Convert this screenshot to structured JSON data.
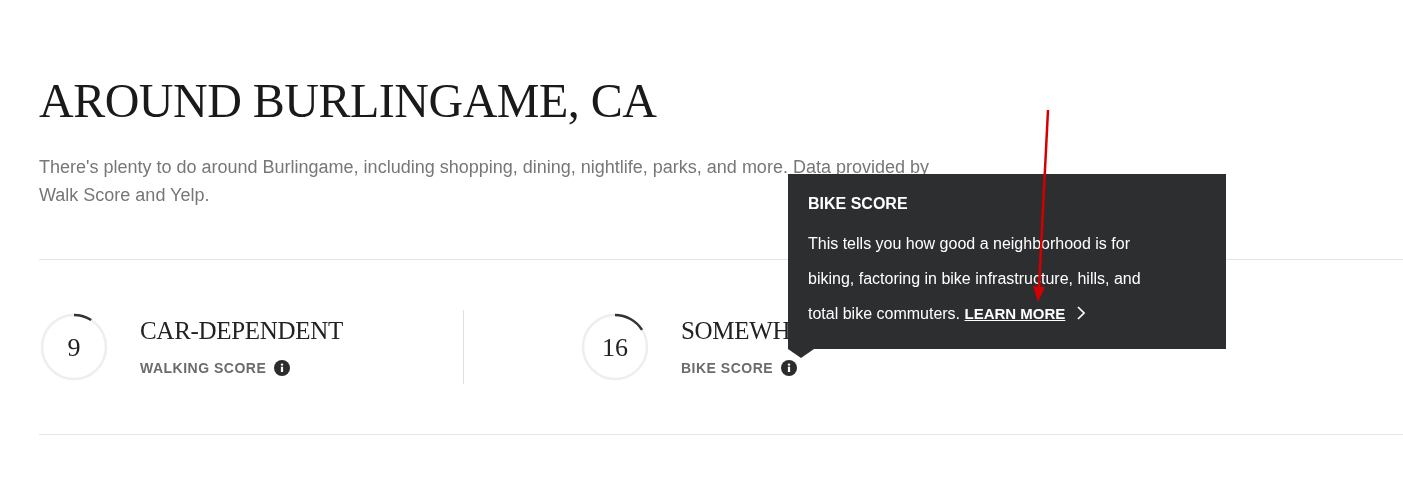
{
  "title": "AROUND BURLINGAME, CA",
  "intro_lines": [
    "There's plenty to do around Burlingame, including shopping, dining, nightlife, parks, and more. Data provided by",
    "Walk Score and Yelp."
  ],
  "scores": [
    {
      "value": "9",
      "level": 0.09,
      "heading": "CAR-DEPENDENT",
      "label": "WALKING SCORE"
    },
    {
      "value": "16",
      "level": 0.16,
      "heading": "SOMEWH",
      "label": "BIKE SCORE"
    }
  ],
  "tooltip": {
    "title": "BIKE SCORE",
    "body": "This tells you how good a neighborhood is for biking, factoring in bike infrastructure, hills, and total bike commuters.",
    "link": "LEARN MORE"
  }
}
